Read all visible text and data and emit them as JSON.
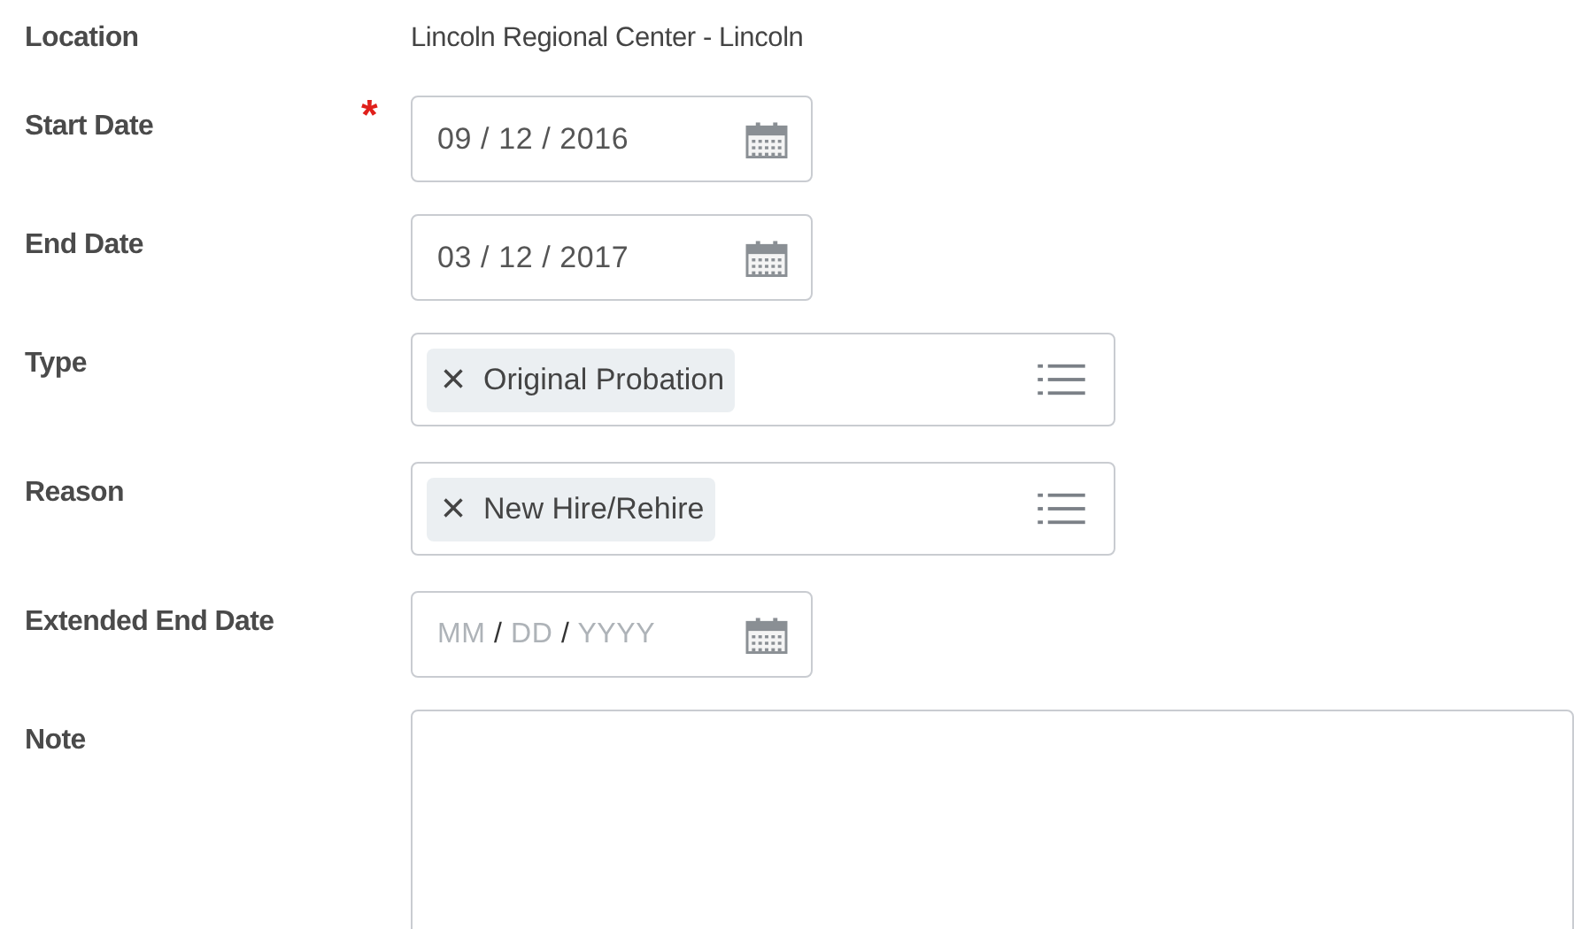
{
  "fields": [
    {
      "kind": "text",
      "label": "Location",
      "required": false,
      "value": "Lincoln Regional Center - Lincoln"
    },
    {
      "kind": "date",
      "label": "Start Date",
      "required": true,
      "required_mark": "*",
      "value": "09 / 12 / 2016"
    },
    {
      "kind": "date",
      "label": "End Date",
      "required": false,
      "value": "03 / 12 / 2017"
    },
    {
      "kind": "prompt",
      "label": "Type",
      "required": false,
      "value": "Original Probation",
      "remove": "×"
    },
    {
      "kind": "prompt",
      "label": "Reason",
      "required": false,
      "value": "New Hire/Rehire",
      "remove": "×"
    },
    {
      "kind": "date",
      "label": "Extended End Date",
      "required": false,
      "placeholder": [
        "MM",
        "DD",
        "YYYY"
      ],
      "separator": "/"
    },
    {
      "kind": "textarea",
      "label": "Note",
      "required": false
    }
  ]
}
